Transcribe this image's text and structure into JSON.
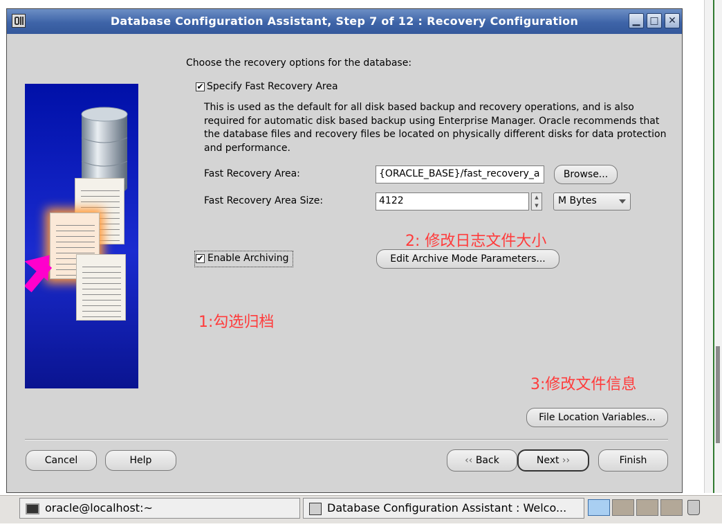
{
  "window": {
    "title": "Database Configuration Assistant, Step 7 of 12 : Recovery Configuration",
    "controls": {
      "minimize": "▁",
      "maximize": "□",
      "close": "✕"
    }
  },
  "content": {
    "intro": "Choose the recovery options for the database:",
    "fast_recovery": {
      "checkbox_label": "Specify Fast Recovery Area",
      "checked": true,
      "description": "This is used as the default for all disk based backup and recovery operations, and is also required for automatic disk based backup using Enterprise Manager. Oracle recommends that the database files and recovery files be located on physically different disks for data protection and performance.",
      "area_label": "Fast Recovery Area:",
      "area_value": "{ORACLE_BASE}/fast_recovery_a",
      "browse_label": "Browse...",
      "size_label": "Fast Recovery Area Size:",
      "size_value": "4122",
      "unit_value": "M Bytes"
    },
    "archiving": {
      "checkbox_label": "Enable Archiving",
      "checked": true,
      "edit_button": "Edit Archive Mode Parameters..."
    },
    "file_location_button": "File Location Variables...",
    "annotations": {
      "a1": "1:勾选归档",
      "a2": "2:  修改日志文件大小",
      "a3": "3:修改文件信息"
    }
  },
  "footer": {
    "cancel": "Cancel",
    "help": "Help",
    "back": "Back",
    "next": "Next",
    "finish": "Finish"
  },
  "taskbar": {
    "terminal": "oracle@localhost:~",
    "dbca": "Database Configuration Assistant : Welco..."
  }
}
